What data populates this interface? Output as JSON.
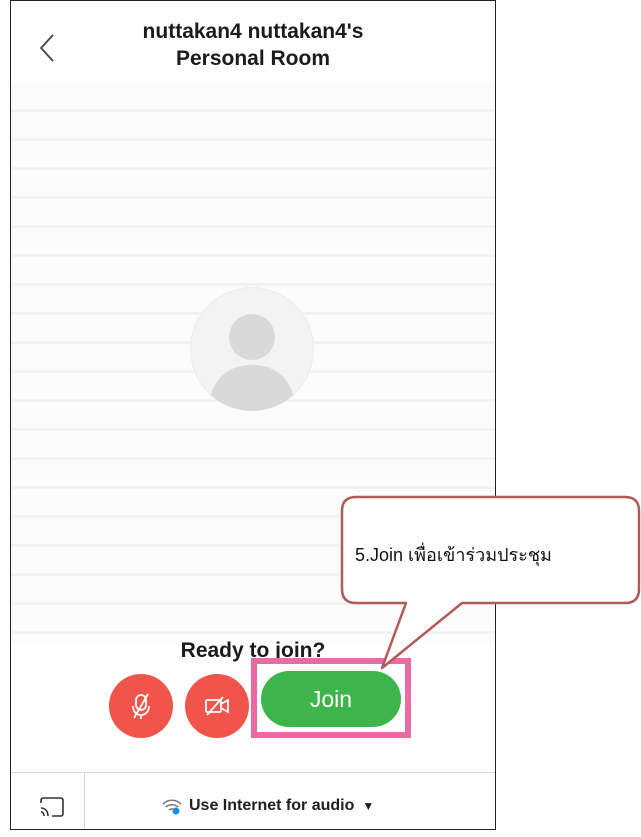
{
  "header": {
    "title_line1": "nuttakan4 nuttakan4's",
    "title_line2": "Personal Room",
    "back_icon": "chevron-left-icon"
  },
  "main": {
    "avatar_icon": "person-silhouette-icon",
    "prompt": "Ready to join?",
    "mute_icon": "microphone-off-icon",
    "video_icon": "video-off-icon",
    "join_label": "Join"
  },
  "bottom_bar": {
    "cast_icon": "cast-icon",
    "audio_label": "Use Internet for audio",
    "audio_icon": "wifi-icon",
    "dropdown_icon": "caret-down-icon"
  },
  "annotation": {
    "callout_text": "5.Join เพื่อเข้าร่วมประชุม"
  },
  "colors": {
    "join": "#3db54a",
    "red_button": "#f0544a",
    "highlight": "#ea6aa1",
    "callout_border": "#b05a5a"
  }
}
